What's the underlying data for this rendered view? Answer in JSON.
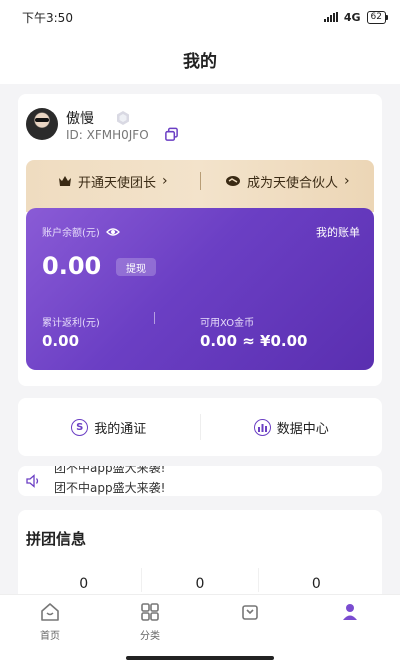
{
  "status_bar": {
    "time": "下午3:50",
    "network": "4G",
    "battery": "62"
  },
  "header": {
    "title": "我的"
  },
  "profile": {
    "username": "傲慢",
    "user_id": "ID: XFMH0JFO"
  },
  "vip": {
    "leader_label": "开通天使团长",
    "partner_label": "成为天使合伙人",
    "chevron": "›"
  },
  "wallet": {
    "balance_label": "账户余额(元)",
    "my_account_label": "我的账单",
    "balance_value": "0.00",
    "withdraw_label": "提现",
    "rebate_label": "累计返利(元)",
    "rebate_value": "0.00",
    "coin_label": "可用XO金币",
    "coin_value": "0.00 ≈ ¥0.00"
  },
  "quick_links": {
    "pass_label": "我的通证",
    "pass_icon_glyph": "S",
    "data_label": "数据中心"
  },
  "notice": {
    "line1": "团不中app盛大来袭!",
    "line2": "团不中app盛大来袭!"
  },
  "group_info": {
    "title": "拼团信息",
    "stats": [
      "0",
      "0",
      "0"
    ]
  },
  "tab_bar": {
    "home": "首页",
    "category": "分类",
    "cart": "",
    "mine": ""
  },
  "colors": {
    "accent": "#6b3fc4",
    "gold": "#efdcc0"
  }
}
